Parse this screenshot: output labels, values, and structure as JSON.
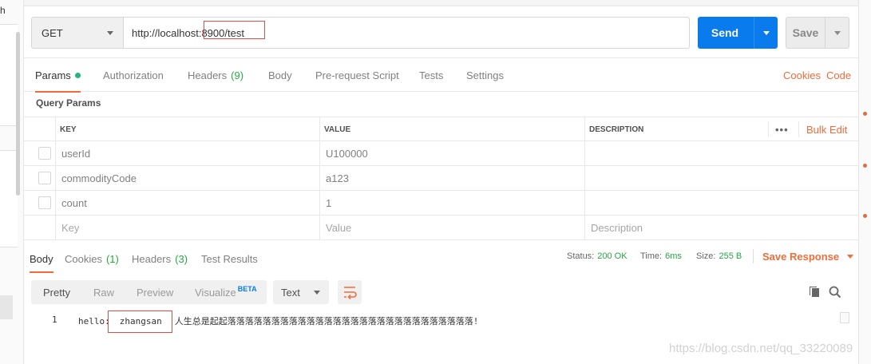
{
  "sidebar_fragment": "h",
  "request": {
    "method": "GET",
    "url": "http://localhost:8900/test",
    "send_label": "Send",
    "save_label": "Save"
  },
  "tabs": [
    {
      "label": "Params",
      "active": true
    },
    {
      "label": "Authorization"
    },
    {
      "label": "Headers",
      "count": "(9)"
    },
    {
      "label": "Body"
    },
    {
      "label": "Pre-request Script"
    },
    {
      "label": "Tests"
    },
    {
      "label": "Settings"
    }
  ],
  "tab_links": {
    "cookies": "Cookies",
    "code": "Code"
  },
  "query_params": {
    "title": "Query Params",
    "columns": [
      "KEY",
      "VALUE",
      "DESCRIPTION"
    ],
    "bulk_edit": "Bulk Edit",
    "more": "•••",
    "rows": [
      {
        "key": "userId",
        "value": "U100000",
        "description": ""
      },
      {
        "key": "commodityCode",
        "value": "a123",
        "description": ""
      },
      {
        "key": "count",
        "value": "1",
        "description": ""
      }
    ],
    "placeholder": {
      "key": "Key",
      "value": "Value",
      "description": "Description"
    }
  },
  "response": {
    "tabs": [
      {
        "label": "Body",
        "active": true
      },
      {
        "label": "Cookies",
        "count": "(1)"
      },
      {
        "label": "Headers",
        "count": "(3)"
      },
      {
        "label": "Test Results"
      }
    ],
    "status_label": "Status:",
    "status": "200 OK",
    "time_label": "Time:",
    "time": "6ms",
    "size_label": "Size:",
    "size": "255 B",
    "save_response": "Save Response",
    "formats": [
      "Pretty",
      "Raw",
      "Preview",
      "Visualize"
    ],
    "beta": "BETA",
    "language": "Text",
    "line_number": "1",
    "body_prefix": "hello:",
    "body_name": "zhangsan",
    "body_cn": "人生总是起起落落落落落落落落落落落落落落落落落落落落落落落落落落落落!"
  },
  "watermark": "https://blog.csdn.net/qq_33220089",
  "colors": {
    "accent": "#f26b3a",
    "send": "#097bed",
    "green": "#26a744",
    "highlight_box": "#e34b4b"
  }
}
